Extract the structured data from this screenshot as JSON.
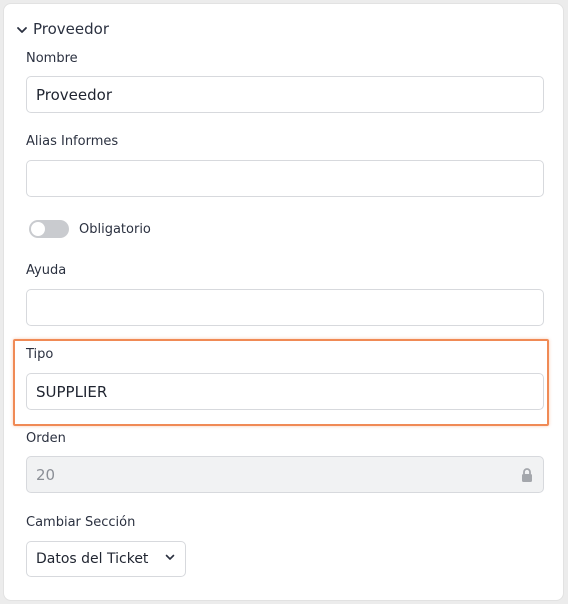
{
  "section": {
    "title": "Proveedor",
    "icon": "chevron-down-icon"
  },
  "fields": {
    "nombre": {
      "label": "Nombre",
      "value": "Proveedor"
    },
    "alias": {
      "label": "Alias Informes",
      "value": ""
    },
    "obligatorio": {
      "label": "Obligatorio",
      "checked": false
    },
    "ayuda": {
      "label": "Ayuda",
      "value": ""
    },
    "tipo": {
      "label": "Tipo",
      "value": "SUPPLIER"
    },
    "orden": {
      "label": "Orden",
      "value": "20",
      "icon": "lock-icon"
    },
    "cambiar_seccion": {
      "label": "Cambiar Sección",
      "value": "Datos del Ticket",
      "icon": "chevron-down-icon"
    }
  },
  "colors": {
    "highlight": "#f08a55",
    "toggle_off": "#c9cbcf",
    "disabled_bg": "#f1f2f3"
  }
}
